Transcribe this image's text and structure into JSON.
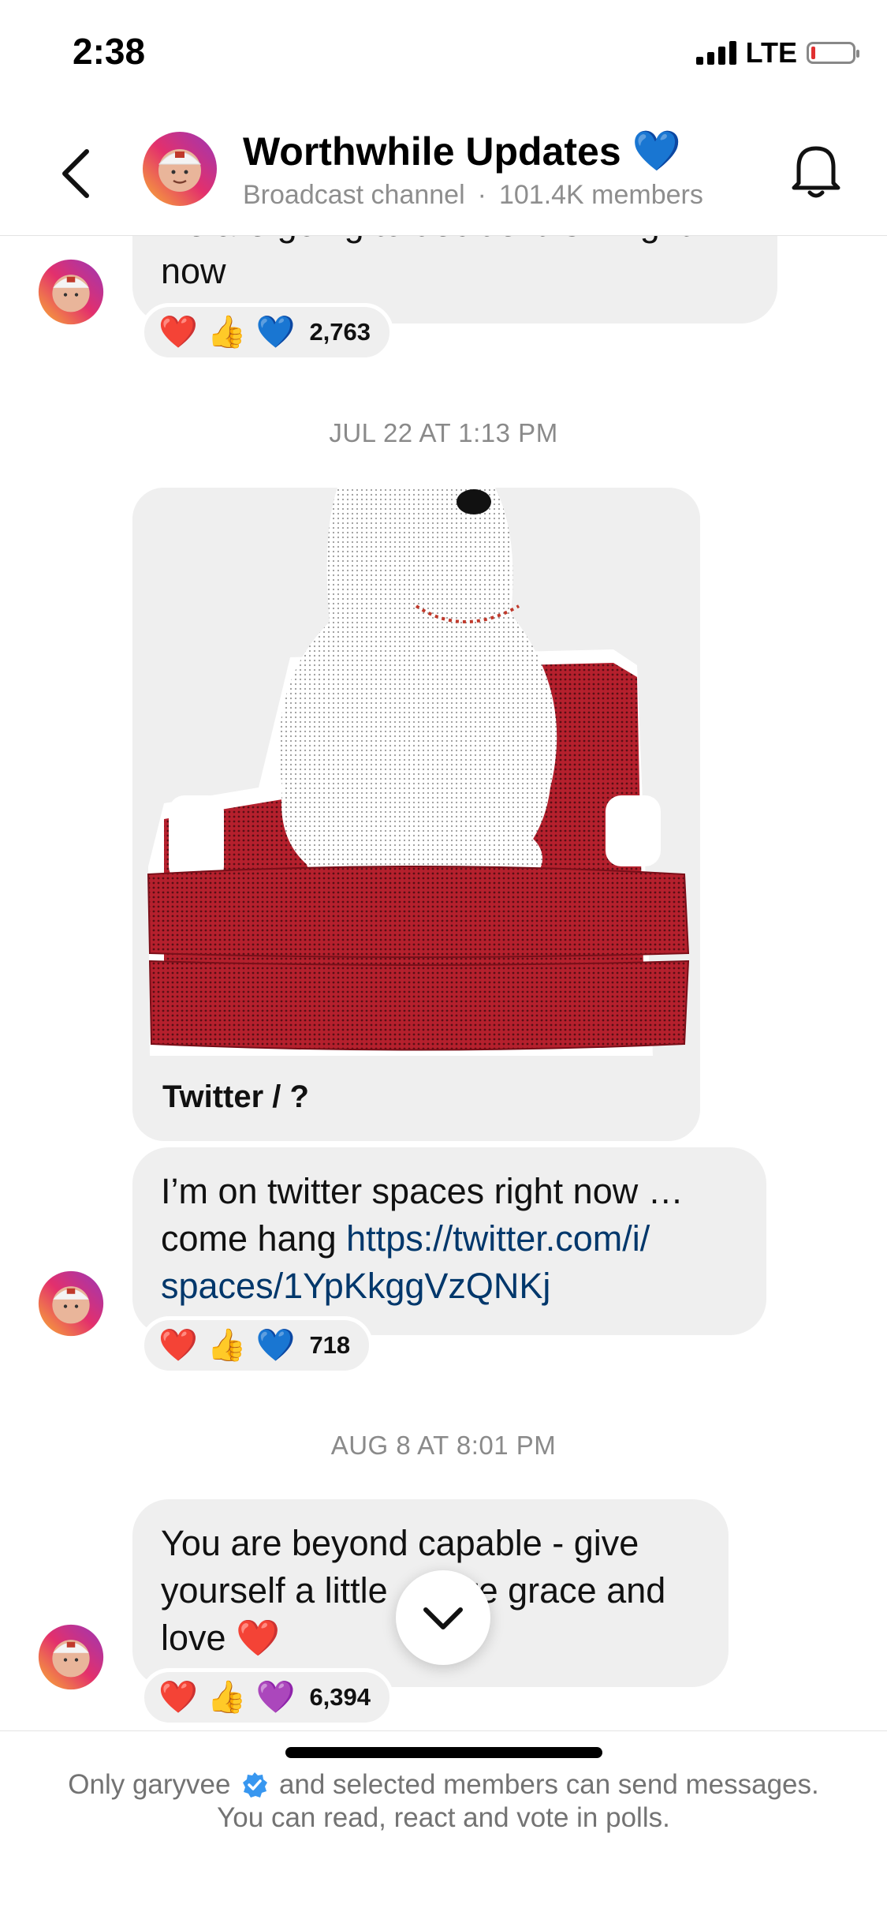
{
  "status_bar": {
    "time": "2:38",
    "network": "LTE",
    "signal_bars": 4,
    "battery_level": 0.08
  },
  "header": {
    "back_icon": "chevron-left-icon",
    "title": "Worthwhile Updates",
    "title_emoji": "💙",
    "subtitle_type": "Broadcast channel",
    "subtitle_sep": "·",
    "subtitle_members": "101.4K members",
    "bell_icon": "bell-icon"
  },
  "messages": [
    {
      "text_partial": "we are going to decide it is .. right",
      "text": "now",
      "reactions": {
        "emojis": [
          "❤️",
          "👍",
          "💙"
        ],
        "count": "2,763"
      }
    },
    {
      "timestamp": "JUL 22 AT 1:13 PM",
      "card_caption": "Twitter / ?",
      "text": "I’m on twitter spaces right now …",
      "text_line2": "come hang ",
      "link_line2": "https://twitter.com/i/",
      "link_line3": "spaces/1YpKkggVzQNKj",
      "reactions": {
        "emojis": [
          "❤️",
          "👍",
          "💙"
        ],
        "count": "718"
      }
    },
    {
      "timestamp": "AUG 8 AT 8:01 PM",
      "line1": "You are beyond capable - give",
      "line2a": "yourself a little",
      "line2b": "re grace and",
      "line3": "love ❤️",
      "reactions": {
        "emojis": [
          "❤️",
          "👍",
          "💜"
        ],
        "count": "6,394"
      }
    }
  ],
  "scroll_down_icon": "chevron-down-icon",
  "footer": {
    "line1_a": "Only garyvee",
    "line1_b": "and selected members can send messages.",
    "line2": "You can read, react and vote in polls."
  }
}
